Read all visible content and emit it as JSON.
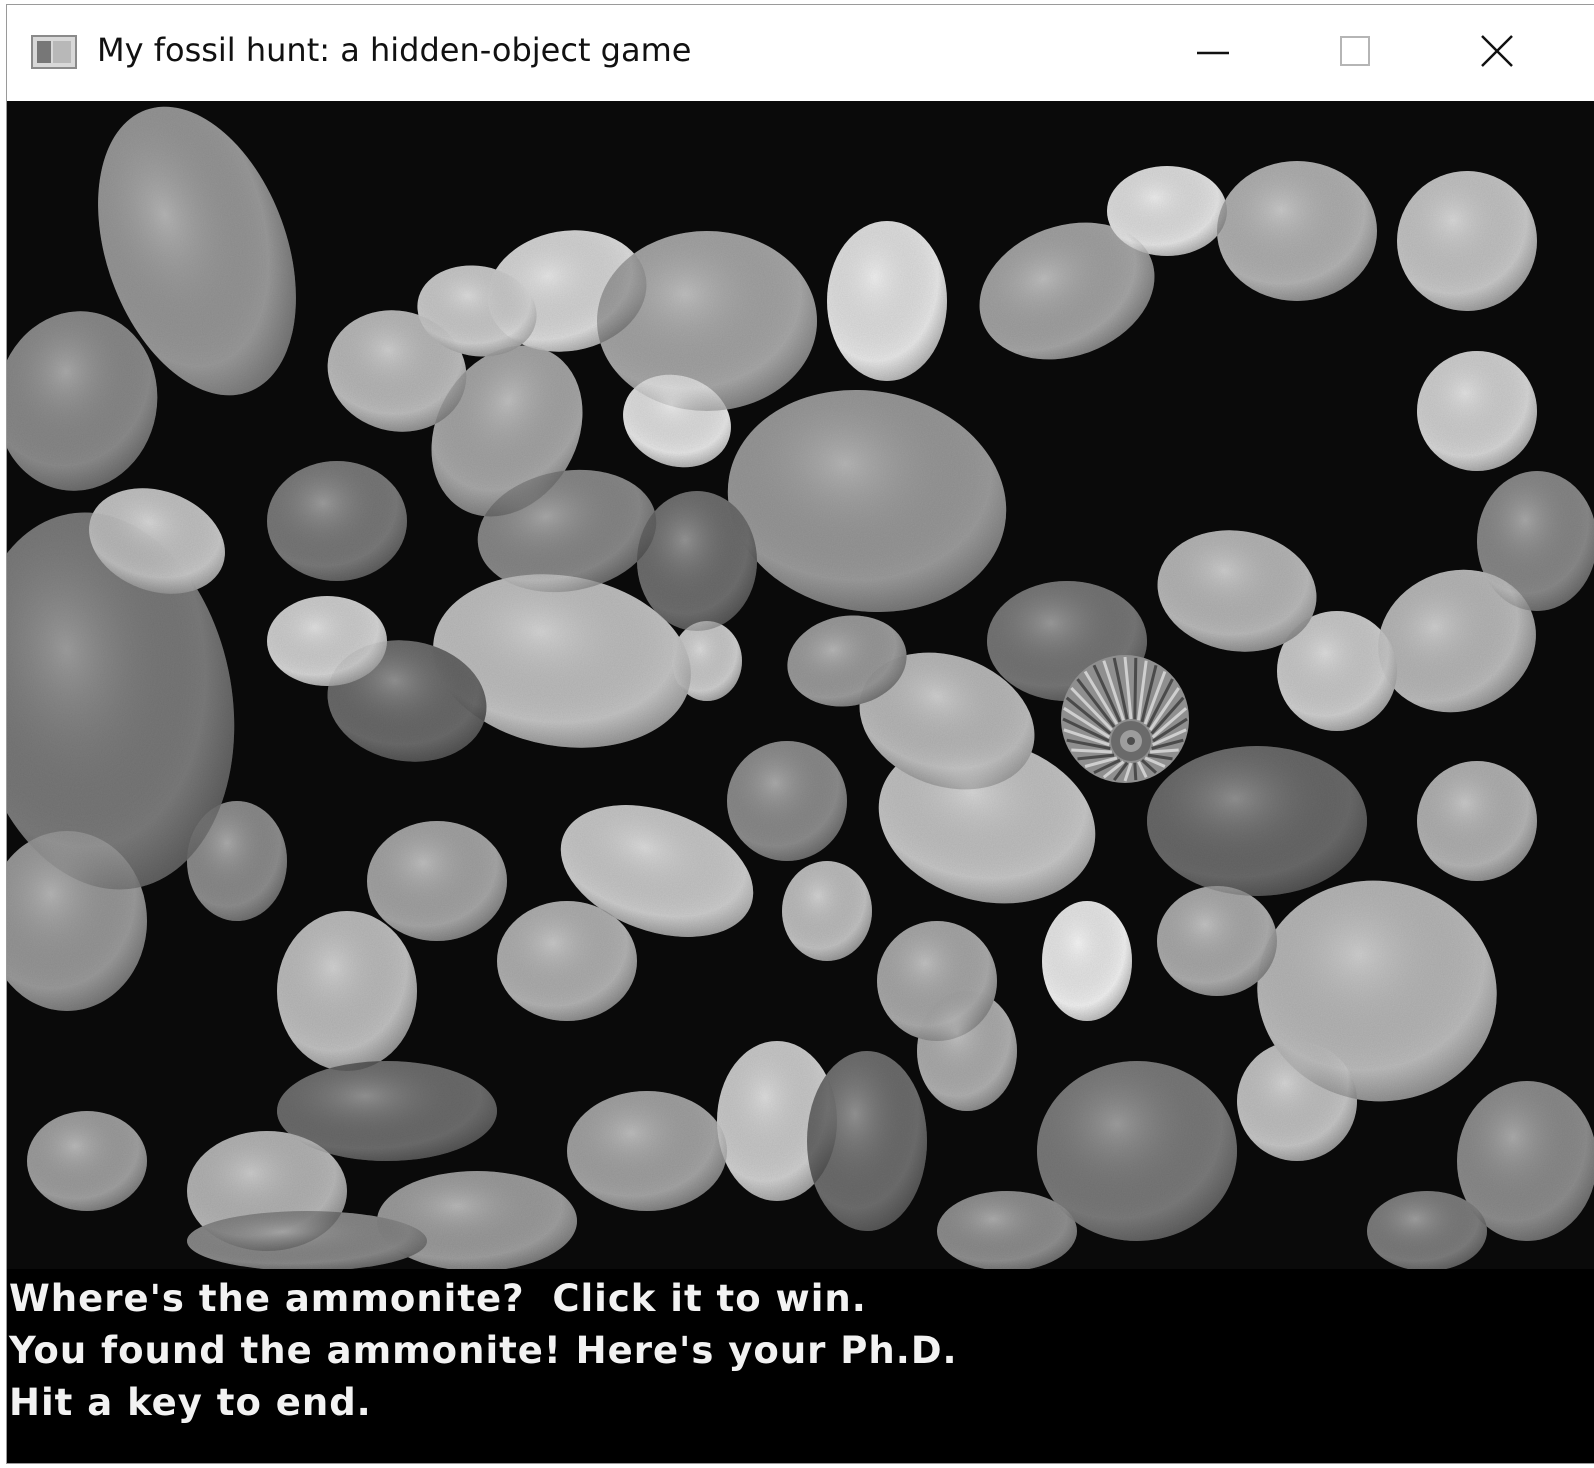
{
  "window": {
    "title": "My fossil hunt: a hidden-object game",
    "icon": "app-window-icon",
    "controls": {
      "minimize_icon": "minimize-icon",
      "maximize_icon": "maximize-icon",
      "close_icon": "close-icon"
    }
  },
  "game": {
    "scene": "grayscale pebbles",
    "hidden_object": "ammonite",
    "ammonite_color": "#9a9a9a"
  },
  "messages": {
    "line1": "Where's the ammonite?  Click it to win.",
    "line2": "You found the ammonite! Here's your Ph.D.",
    "line3": "Hit a key to end."
  },
  "colors": {
    "titlebar_bg": "#ffffff",
    "game_bg": "#070707",
    "message_bg": "#000000",
    "message_text": "#f2f2f2"
  }
}
